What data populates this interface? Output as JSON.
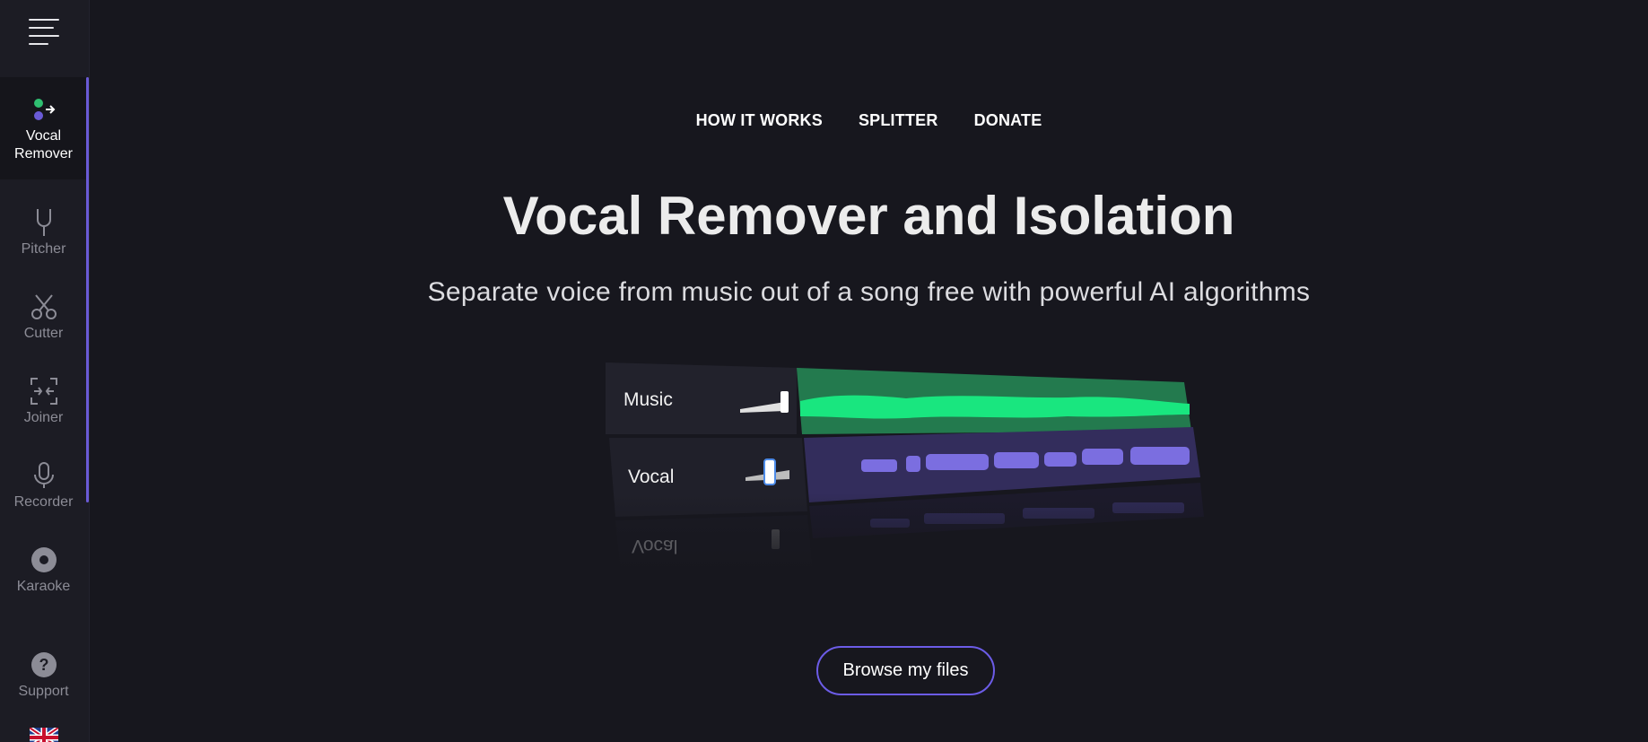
{
  "sidebar": {
    "items": [
      {
        "label_line1": "Vocal",
        "label_line2": "Remover",
        "icon": "vocal-remover-icon",
        "active": true
      },
      {
        "label": "Pitcher",
        "icon": "tuning-fork-icon"
      },
      {
        "label": "Cutter",
        "icon": "scissors-icon"
      },
      {
        "label": "Joiner",
        "icon": "joiner-icon"
      },
      {
        "label": "Recorder",
        "icon": "microphone-icon"
      },
      {
        "label": "Karaoke",
        "icon": "disc-icon"
      },
      {
        "label": "Support",
        "icon": "question-icon"
      }
    ],
    "language_icon": "uk-flag-icon"
  },
  "topnav": {
    "how_it_works": "HOW IT WORKS",
    "splitter": "SPLITTER",
    "donate": "DONATE"
  },
  "hero": {
    "title": "Vocal Remover and Isolation",
    "subtitle": "Separate voice from music out of a song free with powerful AI algorithms"
  },
  "illustration": {
    "track1": "Music",
    "track2": "Vocal",
    "reflection": "Vocal"
  },
  "actions": {
    "browse": "Browse my files"
  },
  "colors": {
    "accent": "#6c5ce7",
    "music_wave": "#19e67f",
    "vocal_wave": "#7b6ee0"
  }
}
